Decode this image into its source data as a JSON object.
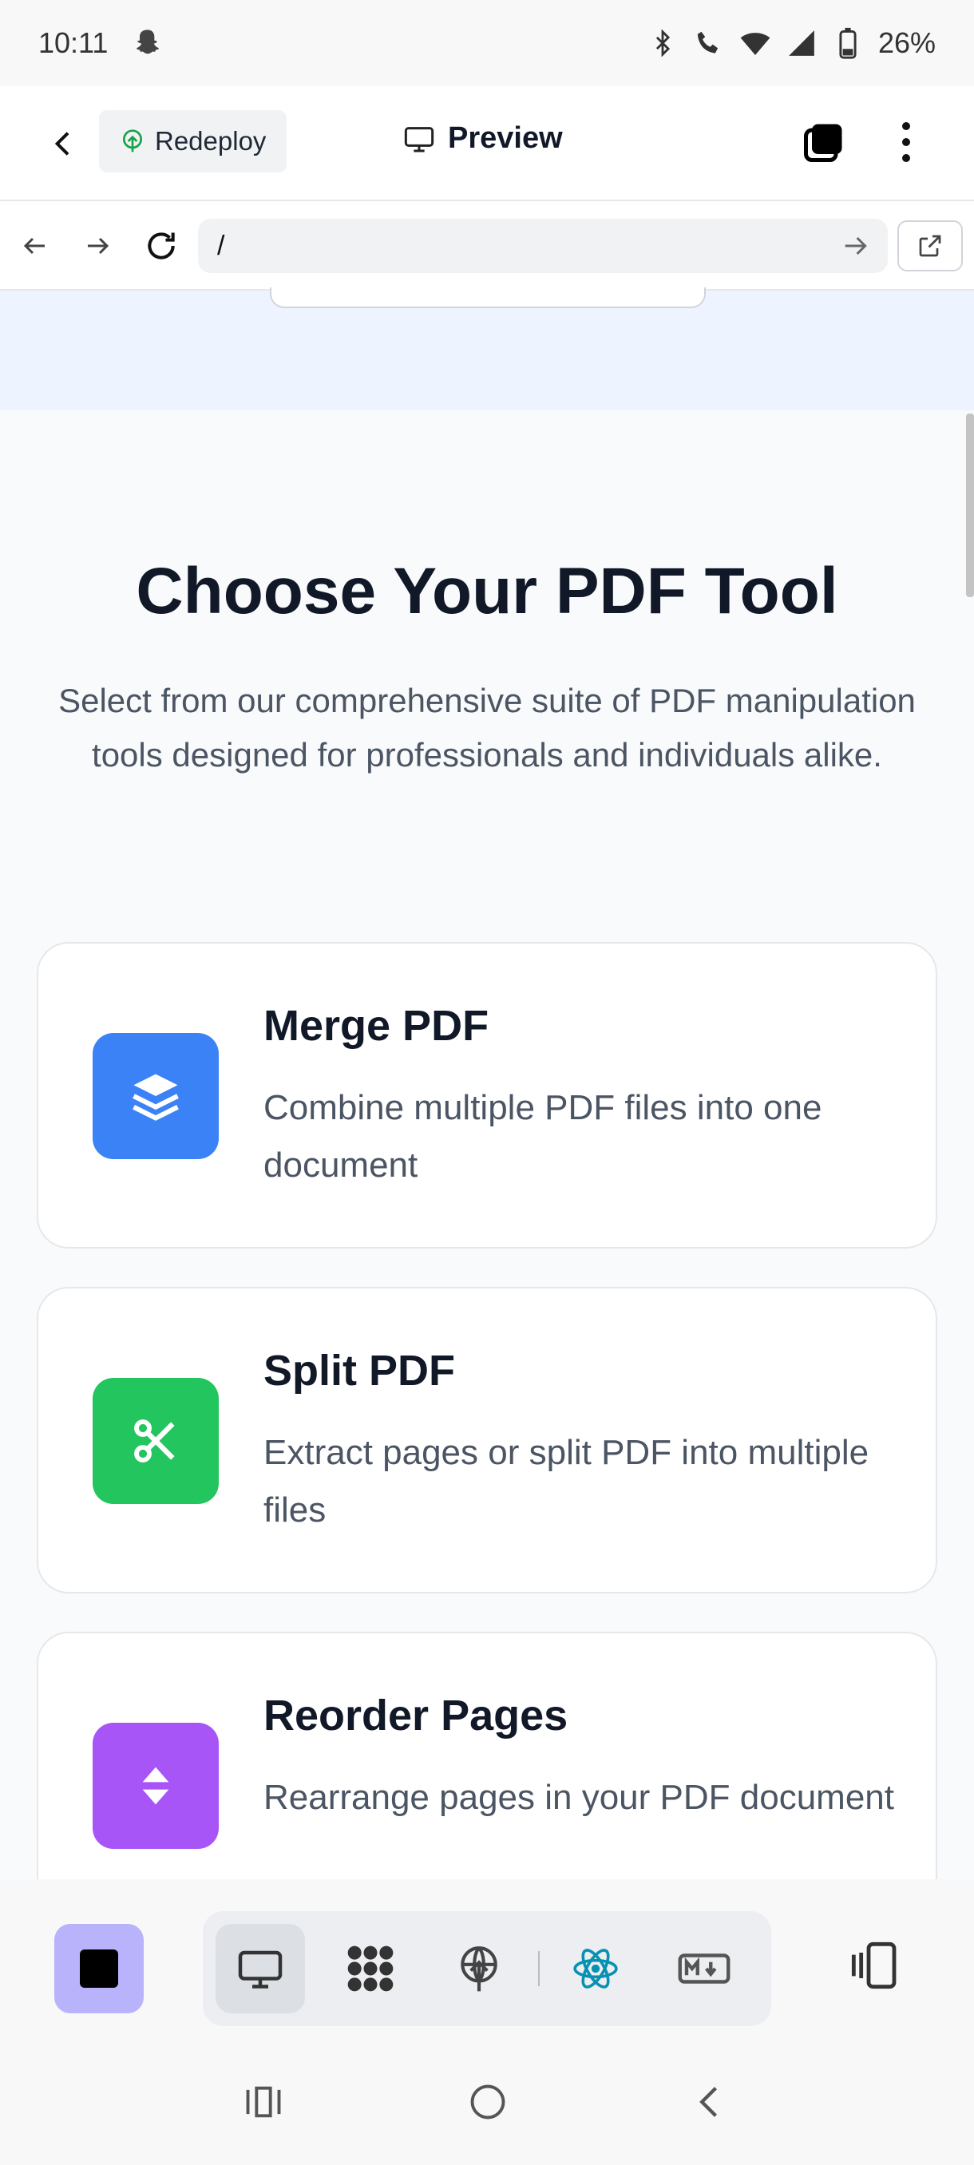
{
  "status_bar": {
    "time": "10:11",
    "battery": "26%"
  },
  "header": {
    "redeploy_label": "Redeploy",
    "preview_label": "Preview"
  },
  "url_bar": {
    "url": "/"
  },
  "section": {
    "title": "Choose Your PDF Tool",
    "subtitle": "Select from our comprehensive suite of PDF manipulation tools designed for professionals and individuals alike."
  },
  "tools": [
    {
      "title": "Merge PDF",
      "description": "Combine multiple PDF files into one document",
      "color": "#3b82f6",
      "icon": "layers-icon"
    },
    {
      "title": "Split PDF",
      "description": "Extract pages or split PDF into multiple files",
      "color": "#22c55e",
      "icon": "scissors-icon"
    },
    {
      "title": "Reorder Pages",
      "description": "Rearrange pages in your PDF document",
      "color": "#a855f7",
      "icon": "sort-icon"
    }
  ],
  "toolbar": {
    "accent": "#b9b3fb",
    "items": [
      "desktop-icon",
      "grid-icon",
      "deploy-icon",
      "react-icon",
      "markdown-icon"
    ]
  }
}
